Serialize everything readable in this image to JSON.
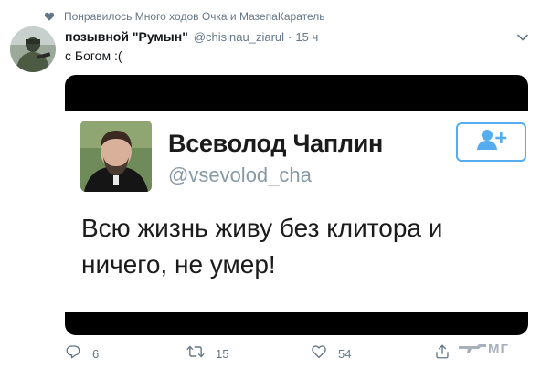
{
  "social_context": {
    "icon": "heart-icon",
    "text": "Понравилось Много ходов Очка и МазепаКаратель"
  },
  "tweet": {
    "author_name": "позывной \"Румын\"",
    "author_handle": "@chisinau_ziarul",
    "separator": "·",
    "time": "15 ч",
    "text": "с Богом :("
  },
  "media_card": {
    "name": "Всеволод Чаплин",
    "handle": "@vsevolod_cha",
    "text": "Всю жизнь живу без клитора и ничего, не умер!",
    "follow_icon": "add-user-icon"
  },
  "actions": {
    "reply_count": "6",
    "retweet_count": "15",
    "like_count": "54"
  },
  "watermark": {
    "text": "МГ"
  },
  "colors": {
    "accent": "#1da1f2",
    "secondary_text": "#657786",
    "follow_border": "#55acee"
  }
}
